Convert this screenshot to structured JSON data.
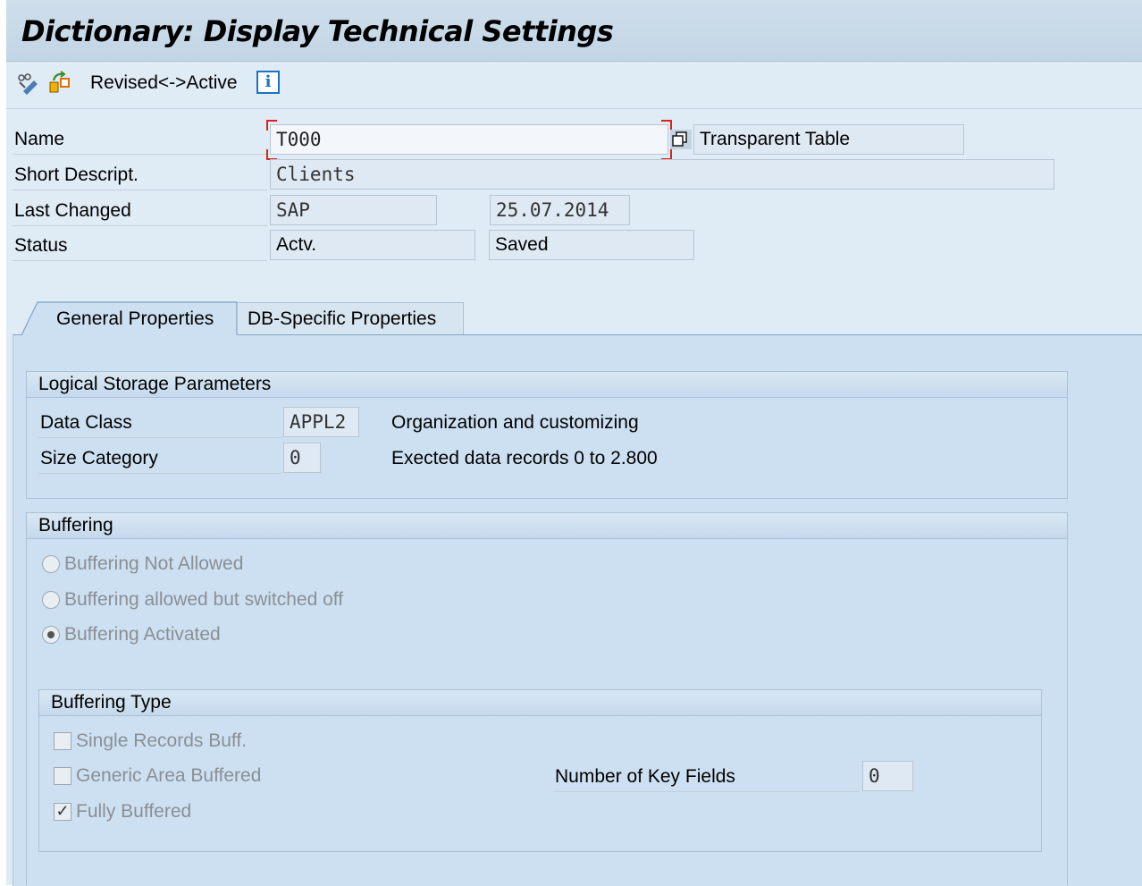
{
  "window": {
    "title": "Dictionary: Display Technical Settings"
  },
  "toolbar": {
    "icons": [
      "display-change-icon",
      "other-object-icon",
      "info-icon"
    ],
    "revised_active_label": "Revised<->Active",
    "info_glyph": "i"
  },
  "header": {
    "name_label": "Name",
    "name_value": "T000",
    "table_type": "Transparent Table",
    "short_desc_label": "Short Descript.",
    "short_desc_value": "Clients",
    "last_changed_label": "Last Changed",
    "last_changed_user": "SAP",
    "last_changed_date": "25.07.2014",
    "status_label": "Status",
    "status_value": "Actv.",
    "status_saved": "Saved"
  },
  "tabs": [
    {
      "label": "General Properties",
      "active": true
    },
    {
      "label": "DB-Specific Properties",
      "active": false
    }
  ],
  "logical_storage": {
    "title": "Logical Storage Parameters",
    "data_class_label": "Data Class",
    "data_class_value": "APPL2",
    "data_class_desc": "Organization and customizing",
    "size_category_label": "Size Category",
    "size_category_value": "0",
    "size_category_desc": "Exected data records 0 to 2.800"
  },
  "buffering": {
    "title": "Buffering",
    "options": [
      {
        "label": "Buffering Not Allowed",
        "selected": false
      },
      {
        "label": "Buffering allowed but switched off",
        "selected": false
      },
      {
        "label": "Buffering Activated",
        "selected": true
      }
    ]
  },
  "buffering_type": {
    "title": "Buffering Type",
    "options": [
      {
        "label": "Single Records Buff.",
        "checked": false
      },
      {
        "label": "Generic Area Buffered",
        "checked": false
      },
      {
        "label": "Fully Buffered",
        "checked": true
      }
    ],
    "key_fields_label": "Number of Key Fields",
    "key_fields_value": "0",
    "check_glyph": "✓"
  },
  "colors": {
    "title_bar": "#c2d5e6",
    "panel": "#cde0f2",
    "focus_marker": "#e02020",
    "info_blue": "#1a73c4"
  }
}
